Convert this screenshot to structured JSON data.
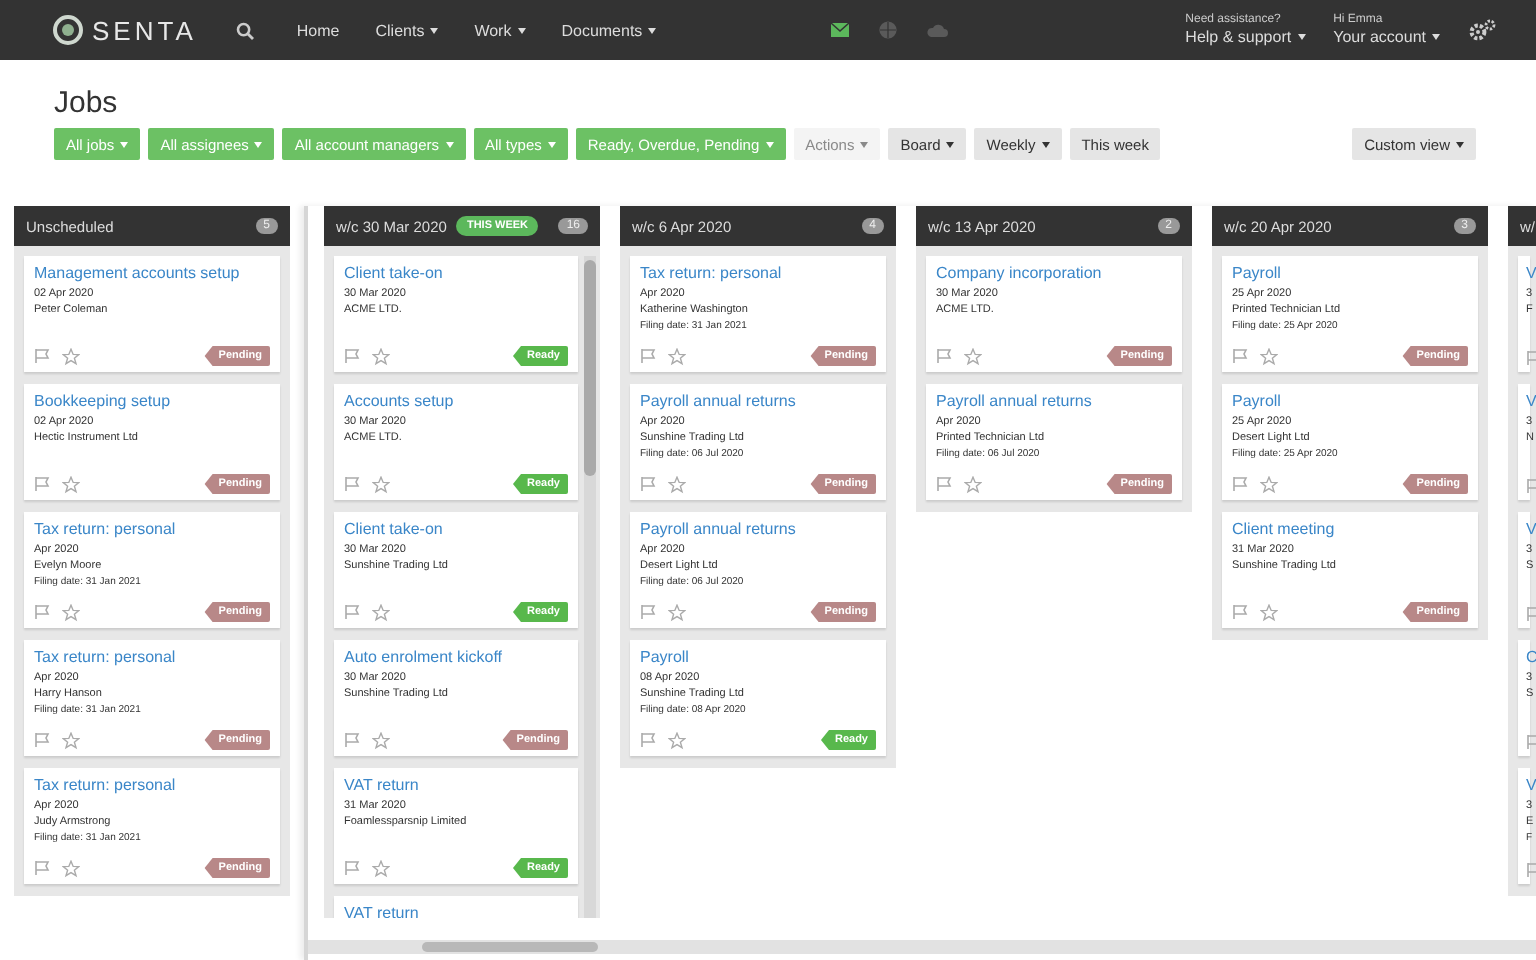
{
  "topbar": {
    "logo": "SENTA",
    "nav": [
      {
        "label": "Home",
        "dropdown": false
      },
      {
        "label": "Clients",
        "dropdown": true
      },
      {
        "label": "Work",
        "dropdown": true
      },
      {
        "label": "Documents",
        "dropdown": true
      }
    ],
    "status_icons": [
      {
        "kind": "mail",
        "on": true
      },
      {
        "kind": "globe",
        "on": false
      },
      {
        "kind": "cloud",
        "on": false
      }
    ],
    "help": {
      "caption": "Need assistance?",
      "label": "Help & support"
    },
    "account": {
      "caption": "Hi Emma",
      "label": "Your account"
    }
  },
  "page_title": "Jobs",
  "filters": [
    {
      "label": "All jobs",
      "kind": "green",
      "dropdown": true,
      "disabled": false
    },
    {
      "label": "All assignees",
      "kind": "green",
      "dropdown": true,
      "disabled": false
    },
    {
      "label": "All account managers",
      "kind": "green",
      "dropdown": true,
      "disabled": false
    },
    {
      "label": "All types",
      "kind": "green",
      "dropdown": true,
      "disabled": false
    },
    {
      "label": "Ready, Overdue, Pending",
      "kind": "green",
      "dropdown": true,
      "disabled": false
    },
    {
      "label": "Actions",
      "kind": "grey",
      "dropdown": true,
      "disabled": true
    },
    {
      "label": "Board",
      "kind": "grey",
      "dropdown": true,
      "disabled": false
    },
    {
      "label": "Weekly",
      "kind": "grey",
      "dropdown": true,
      "disabled": false
    },
    {
      "label": "This week",
      "kind": "grey",
      "dropdown": false,
      "disabled": false
    }
  ],
  "custom_view": {
    "label": "Custom view",
    "dropdown": true
  },
  "columns": [
    {
      "title": "Unscheduled",
      "count": "5",
      "cards": [
        {
          "title": "Management accounts setup",
          "date": "02 Apr 2020",
          "client": "Peter Coleman",
          "status": {
            "kind": "pending",
            "label": "Pending"
          }
        },
        {
          "title": "Bookkeeping setup",
          "date": "02 Apr 2020",
          "client": "Hectic Instrument Ltd",
          "status": {
            "kind": "pending",
            "label": "Pending"
          }
        },
        {
          "title": "Tax return: personal",
          "date": "Apr 2020",
          "client": "Evelyn Moore",
          "filing": "Filing date: 31 Jan 2021",
          "status": {
            "kind": "pending",
            "label": "Pending"
          }
        },
        {
          "title": "Tax return: personal",
          "date": "Apr 2020",
          "client": "Harry Hanson",
          "filing": "Filing date: 31 Jan 2021",
          "status": {
            "kind": "pending",
            "label": "Pending"
          }
        },
        {
          "title": "Tax return: personal",
          "date": "Apr 2020",
          "client": "Judy Armstrong",
          "filing": "Filing date: 31 Jan 2021",
          "status": {
            "kind": "pending",
            "label": "Pending"
          }
        }
      ]
    },
    {
      "title": "w/c 30 Mar 2020",
      "badge": "THIS WEEK",
      "count": "16",
      "scrollable": true,
      "cards": [
        {
          "title": "Client take-on",
          "date": "30 Mar 2020",
          "client": "ACME LTD.",
          "status": {
            "kind": "ready",
            "label": "Ready"
          }
        },
        {
          "title": "Accounts setup",
          "date": "30 Mar 2020",
          "client": "ACME LTD.",
          "status": {
            "kind": "ready",
            "label": "Ready"
          }
        },
        {
          "title": "Client take-on",
          "date": "30 Mar 2020",
          "client": "Sunshine Trading Ltd",
          "status": {
            "kind": "ready",
            "label": "Ready"
          }
        },
        {
          "title": "Auto enrolment kickoff",
          "date": "30 Mar 2020",
          "client": "Sunshine Trading Ltd",
          "status": {
            "kind": "pending",
            "label": "Pending"
          }
        },
        {
          "title": "VAT return",
          "date": "31 Mar 2020",
          "client": "Foamlessparsnip Limited",
          "status": {
            "kind": "ready",
            "label": "Ready"
          }
        },
        {
          "title": "VAT return"
        }
      ]
    },
    {
      "title": "w/c 6 Apr 2020",
      "count": "4",
      "cards": [
        {
          "title": "Tax return: personal",
          "date": "Apr 2020",
          "client": "Katherine Washington",
          "filing": "Filing date: 31 Jan 2021",
          "status": {
            "kind": "pending",
            "label": "Pending"
          }
        },
        {
          "title": "Payroll annual returns",
          "date": "Apr 2020",
          "client": "Sunshine Trading Ltd",
          "filing": "Filing date: 06 Jul 2020",
          "status": {
            "kind": "pending",
            "label": "Pending"
          }
        },
        {
          "title": "Payroll annual returns",
          "date": "Apr 2020",
          "client": "Desert Light Ltd",
          "filing": "Filing date: 06 Jul 2020",
          "status": {
            "kind": "pending",
            "label": "Pending"
          }
        },
        {
          "title": "Payroll",
          "date": "08 Apr 2020",
          "client": "Sunshine Trading Ltd",
          "filing": "Filing date: 08 Apr 2020",
          "status": {
            "kind": "ready",
            "label": "Ready"
          }
        }
      ]
    },
    {
      "title": "w/c 13 Apr 2020",
      "count": "2",
      "cards": [
        {
          "title": "Company incorporation",
          "date": "30 Mar 2020",
          "client": "ACME LTD.",
          "status": {
            "kind": "pending",
            "label": "Pending"
          }
        },
        {
          "title": "Payroll annual returns",
          "date": "Apr 2020",
          "client": "Printed Technician Ltd",
          "filing": "Filing date: 06 Jul 2020",
          "status": {
            "kind": "pending",
            "label": "Pending"
          }
        }
      ]
    },
    {
      "title": "w/c 20 Apr 2020",
      "count": "3",
      "cards": [
        {
          "title": "Payroll",
          "date": "25 Apr 2020",
          "client": "Printed Technician Ltd",
          "filing": "Filing date: 25 Apr 2020",
          "status": {
            "kind": "pending",
            "label": "Pending"
          }
        },
        {
          "title": "Payroll",
          "date": "25 Apr 2020",
          "client": "Desert Light Ltd",
          "filing": "Filing date: 25 Apr 2020",
          "status": {
            "kind": "pending",
            "label": "Pending"
          }
        },
        {
          "title": "Client meeting",
          "date": "31 Mar 2020",
          "client": "Sunshine Trading Ltd",
          "status": {
            "kind": "pending",
            "label": "Pending"
          }
        }
      ]
    },
    {
      "title": "w/",
      "cards": [
        {
          "title": "V",
          "date": "3",
          "client": "F"
        },
        {
          "title": "V",
          "date": "3",
          "client": "N"
        },
        {
          "title": "V",
          "date": "3",
          "client": "S"
        },
        {
          "title": "C",
          "date": "3",
          "client": "S"
        },
        {
          "title": "V",
          "date": "3",
          "client": "E",
          "filing": "F"
        }
      ]
    }
  ]
}
